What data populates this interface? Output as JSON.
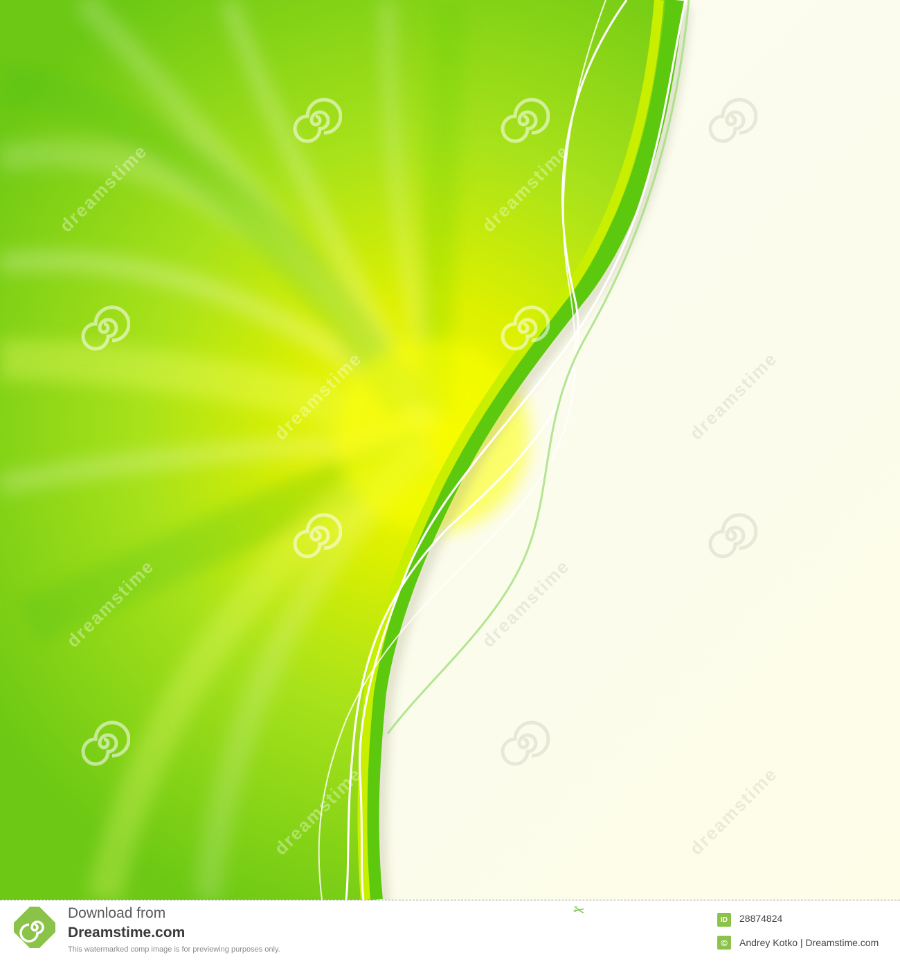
{
  "image": {
    "colors": {
      "green_dark": "#5cc80e",
      "green_mid": "#8fd81a",
      "yellow_center": "#f2f700",
      "cream_panel": "#fcfdee",
      "accent_green": "#8bc34a"
    },
    "watermark": {
      "brand": "dreamstime",
      "icon": "swirl-icon"
    }
  },
  "footer": {
    "download_line": "Download from",
    "site_name": "Dreamstime.com",
    "notice": "This watermarked comp image is for previewing purposes only.",
    "id_badge": "ID",
    "image_id": "28874824",
    "copyright_badge": "©",
    "credit": "Andrey Kotko | Dreamstime.com",
    "scissors_icon": "scissors-icon"
  }
}
